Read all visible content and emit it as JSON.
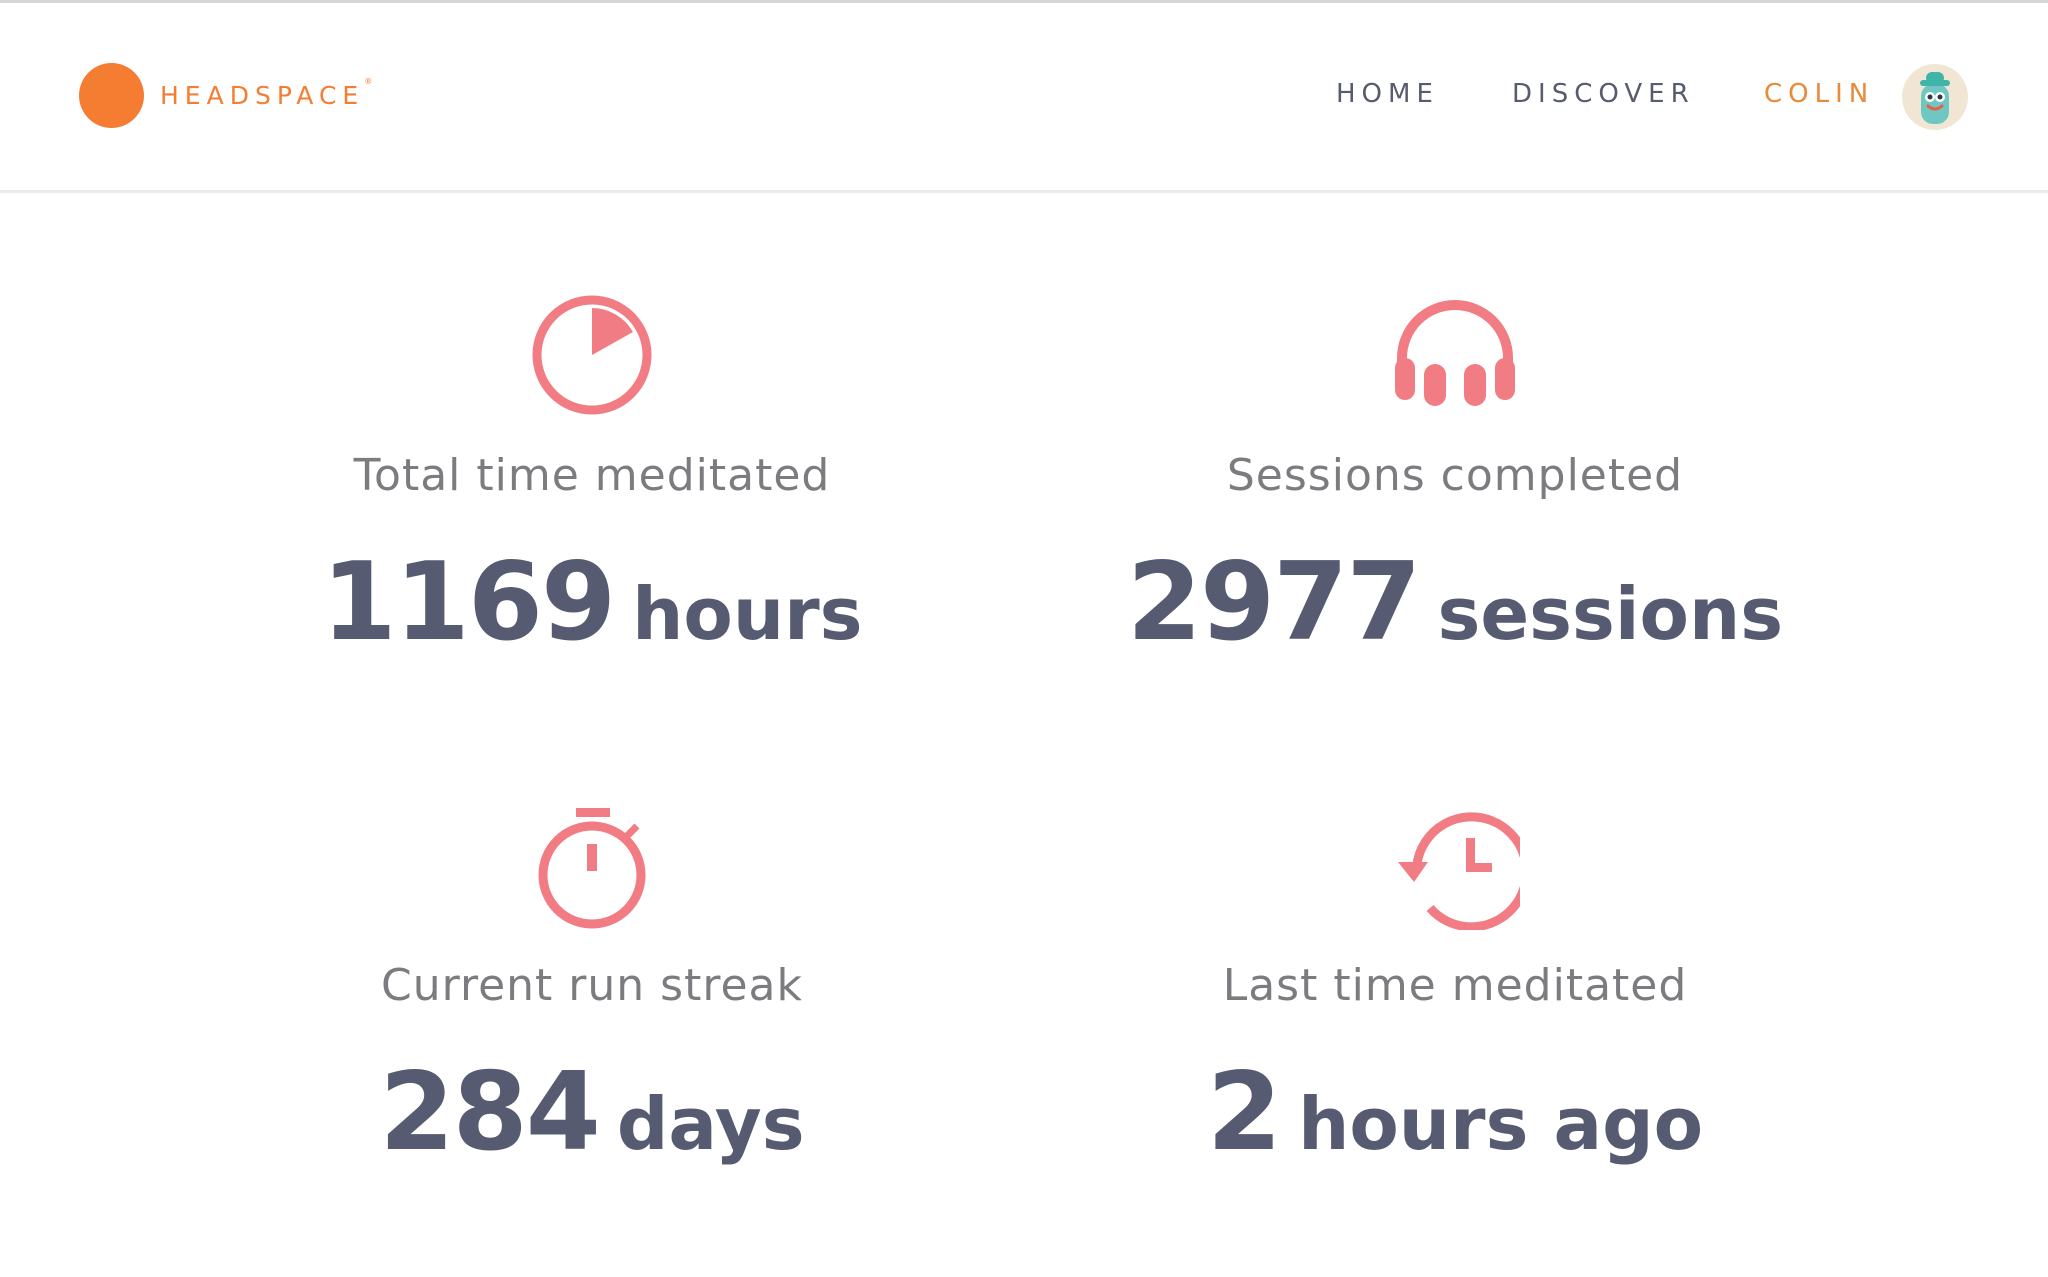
{
  "header": {
    "brand": "HEADSPACE",
    "brand_mark": "®",
    "nav": {
      "home": "HOME",
      "discover": "DISCOVER",
      "user": "COLIN"
    },
    "avatar_icon": "monster-avatar-icon"
  },
  "colors": {
    "brand_orange": "#f47d31",
    "accent_pink": "#f27c83",
    "value_slate": "#575b72",
    "label_gray": "#7c7c80"
  },
  "stats": [
    {
      "icon": "pie-timer-icon",
      "label": "Total time meditated",
      "number": "1169",
      "unit": "hours"
    },
    {
      "icon": "headphones-icon",
      "label": "Sessions completed",
      "number": "2977",
      "unit": "sessions"
    },
    {
      "icon": "stopwatch-icon",
      "label": "Current run streak",
      "number": "284",
      "unit": "days"
    },
    {
      "icon": "history-clock-icon",
      "label": "Last time meditated",
      "number": "2",
      "unit": "hours ago"
    }
  ]
}
